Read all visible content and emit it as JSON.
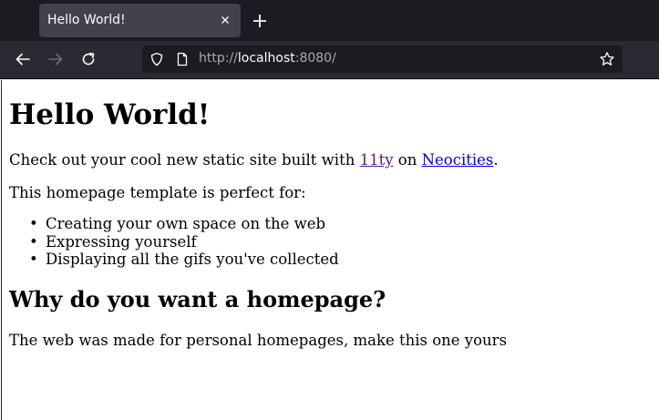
{
  "browser": {
    "tab_title": "Hello World!",
    "url_prefix": "http://",
    "url_host": "localhost",
    "url_suffix": ":8080/",
    "icons": {
      "tab_close": "close-icon",
      "new_tab": "plus-icon",
      "back": "back-arrow-icon",
      "forward": "forward-arrow-icon",
      "reload": "reload-icon",
      "shield": "shield-icon",
      "page": "page-icon",
      "bookmark": "star-icon"
    },
    "colors": {
      "tabbar": "#1c1b22",
      "tab": "#42414d",
      "navbar": "#2b2a33",
      "urlbar": "#1c1b22"
    }
  },
  "page": {
    "heading": "Hello World!",
    "intro_prefix": "Check out your cool new static site built with ",
    "link_11ty": "11ty",
    "intro_middle": " on ",
    "link_neocities": "Neocities",
    "intro_suffix": ".",
    "template_intro": "This homepage template is perfect for:",
    "list_items": [
      "Creating your own space on the web",
      "Expressing yourself",
      "Displaying all the gifs you've collected"
    ],
    "subheading": "Why do you want a homepage?",
    "closing": "The web was made for personal homepages, make this one yours",
    "colors": {
      "visited_link": "#551a8b",
      "link": "#0000ee"
    }
  }
}
